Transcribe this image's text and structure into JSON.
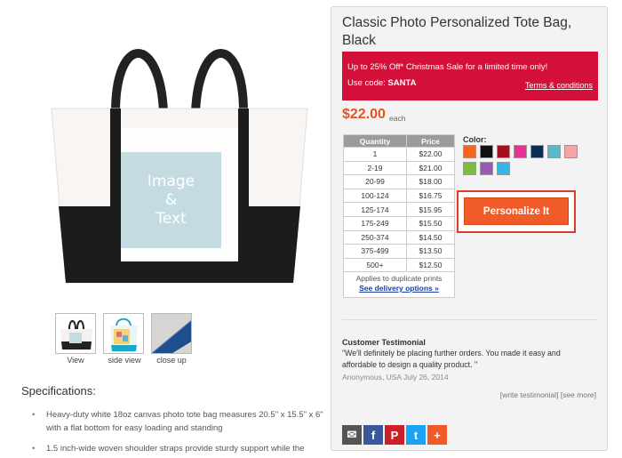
{
  "product": {
    "title": "Classic Photo Personalized Tote Bag, Black",
    "image_overlay": [
      "Image",
      "&",
      "Text"
    ],
    "price": "$22.00",
    "price_suffix": "each"
  },
  "promo": {
    "line1": "Up to 25% Off* Christmas Sale for a limited time only!",
    "code_prefix": "Use code: ",
    "code": "SANTA",
    "terms": "Terms & conditions"
  },
  "thumbnails": [
    {
      "label": "View",
      "icon": "tote-bag-front-icon"
    },
    {
      "label": "side view",
      "icon": "tote-bag-side-icon"
    },
    {
      "label": "close up",
      "icon": "strap-closeup-icon"
    }
  ],
  "specifications": {
    "title": "Specifications:",
    "items": [
      "Heavy-duty white 18oz canvas photo tote bag measures 20.5\" x 15.5\" x 6\" with a flat bottom for easy loading and standing",
      "1.5 inch-wide woven shoulder straps provide sturdy support while the"
    ]
  },
  "quantity_table": {
    "headers": [
      "Quantity",
      "Price"
    ],
    "rows": [
      [
        "1",
        "$22.00"
      ],
      [
        "2-19",
        "$21.00"
      ],
      [
        "20-99",
        "$18.00"
      ],
      [
        "100-124",
        "$16.75"
      ],
      [
        "125-174",
        "$15.95"
      ],
      [
        "175-249",
        "$15.50"
      ],
      [
        "250-374",
        "$14.50"
      ],
      [
        "375-499",
        "$13.50"
      ],
      [
        "500+",
        "$12.50"
      ]
    ],
    "note": "Applies to duplicate prints",
    "delivery_link": "See delivery options »"
  },
  "colors": {
    "label": "Color:",
    "swatches": [
      "#f26522",
      "#111111",
      "#a50e1e",
      "#e0368f",
      "#0d2d52",
      "#58b9c9",
      "#f5a3a6",
      "#7cbd3b",
      "#9b59b6",
      "#36b6e6"
    ]
  },
  "personalize_label": "Personalize It",
  "testimonial": {
    "title": "Customer Testimonial",
    "text": "\"We'll definitely be placing further orders. You made it easy and affordable to design a quality product. \"",
    "meta": "Anonymous, USA July 26, 2014",
    "write_link": "[write testimonial]",
    "more_link": "[see more]"
  },
  "share": [
    {
      "icon": "email-icon",
      "glyph": "✉",
      "color": "#555555"
    },
    {
      "icon": "facebook-icon",
      "glyph": "f",
      "color": "#3b5998"
    },
    {
      "icon": "pinterest-icon",
      "glyph": "P",
      "color": "#cb2027"
    },
    {
      "icon": "twitter-icon",
      "glyph": "t",
      "color": "#1da1f2"
    },
    {
      "icon": "more-share-icon",
      "glyph": "+",
      "color": "#f05a28"
    }
  ]
}
